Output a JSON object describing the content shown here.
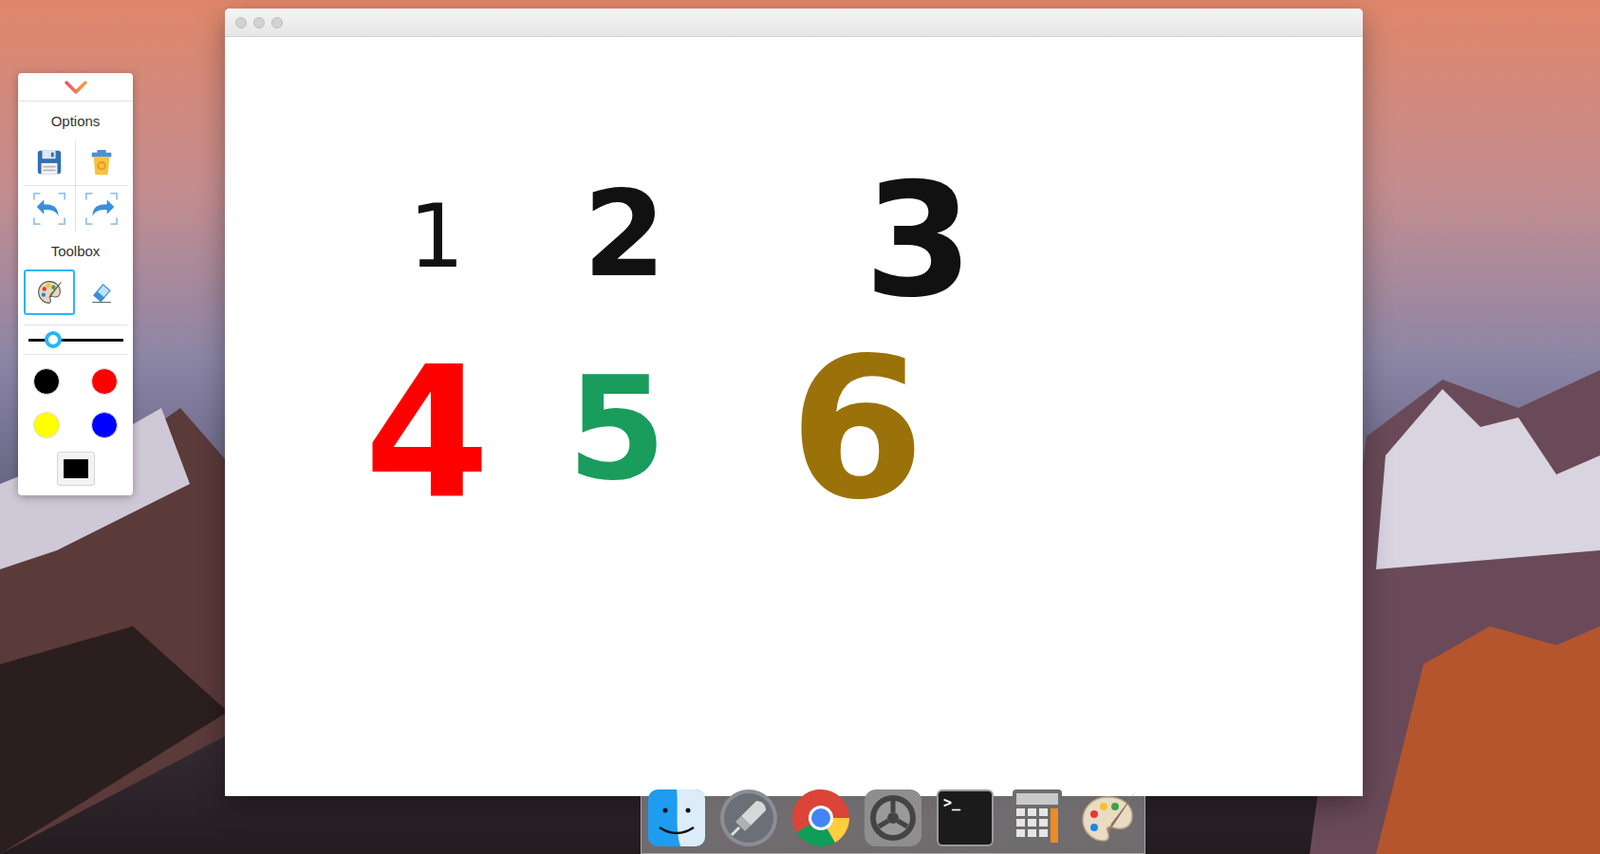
{
  "toolbox": {
    "options_label": "Options",
    "toolbox_label": "Toolbox",
    "tools": [
      {
        "kind": "palette",
        "selected": true
      },
      {
        "kind": "eraser",
        "selected": false
      }
    ],
    "size": {
      "level": 0.26
    },
    "swatches": [
      {
        "color": "#000000"
      },
      {
        "color": "#ff0000"
      },
      {
        "color": "#ffff00"
      },
      {
        "color": "#0000ff"
      }
    ],
    "current_color": "#000000"
  },
  "canvas": {
    "strokes": [
      {
        "text": "1",
        "color": "#111111",
        "kind": "thin"
      },
      {
        "text": "2",
        "color": "#111111",
        "kind": "bold"
      },
      {
        "text": "3",
        "color": "#111111",
        "kind": "bold"
      },
      {
        "text": "4",
        "color": "#ff0000",
        "kind": "bold"
      },
      {
        "text": "5",
        "color": "#1a9c5c",
        "kind": "bold"
      },
      {
        "text": "6",
        "color": "#9b7209",
        "kind": "bold"
      }
    ]
  },
  "dock": {
    "items": [
      {
        "kind": "finder"
      },
      {
        "kind": "launchpad"
      },
      {
        "kind": "chrome"
      },
      {
        "kind": "settings"
      },
      {
        "kind": "terminal",
        "text": ">_"
      },
      {
        "kind": "calculator"
      },
      {
        "kind": "paint"
      }
    ]
  }
}
